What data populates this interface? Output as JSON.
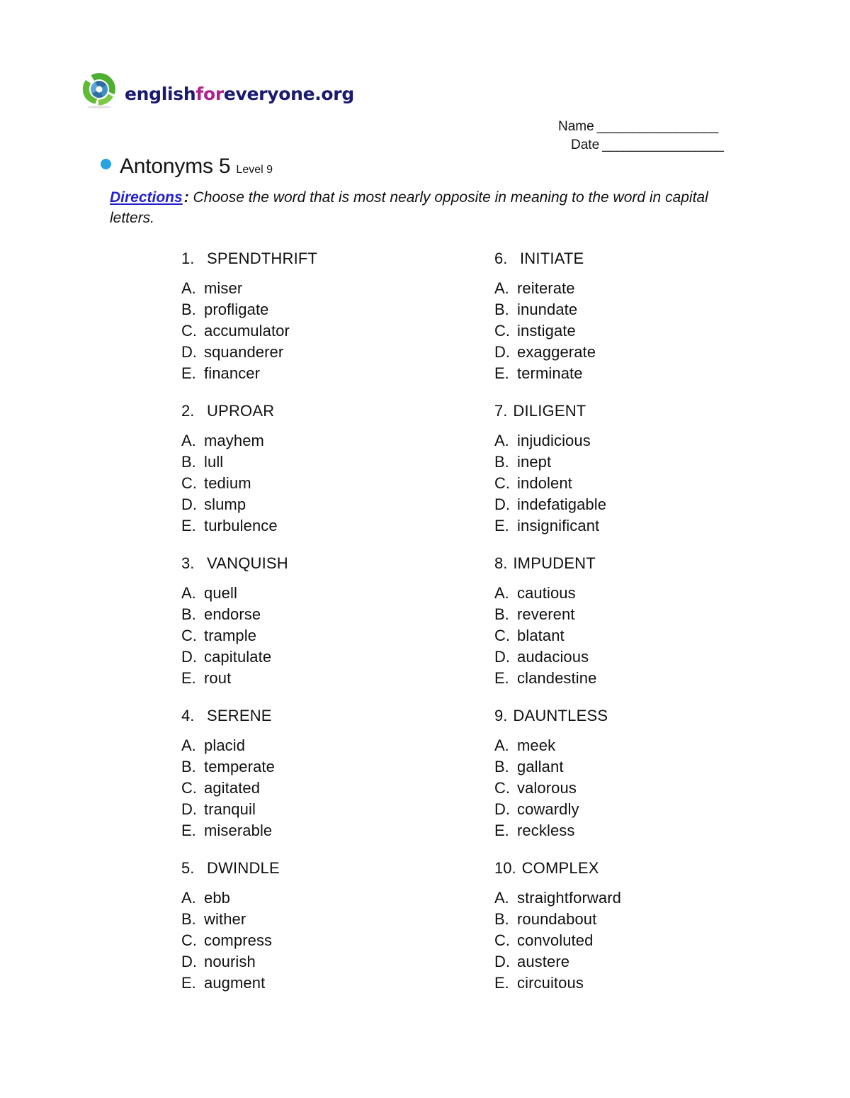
{
  "logo": {
    "icon": "circular-swoosh-logo",
    "word_part1": "english",
    "word_part2": "for",
    "word_part3": "everyone.org",
    "navy": "#1a1a6e",
    "magenta": "#b0228c"
  },
  "header": {
    "name_label": "Name",
    "name_line": "_________________",
    "date_label": "Date",
    "date_line": "_________________"
  },
  "title": {
    "bullet_color": "#29a3e0",
    "main": "Antonyms 5",
    "level": "Level 9"
  },
  "directions": {
    "label": "Directions",
    "colon": ":",
    "text": " Choose the word that is most nearly opposite in meaning to the word in capital letters.",
    "label_color": "#2222cc"
  },
  "questions": [
    {
      "number": "1.",
      "word": "SPENDTHRIFT",
      "options": [
        {
          "letter": "A.",
          "text": "miser"
        },
        {
          "letter": "B.",
          "text": "profligate"
        },
        {
          "letter": "C.",
          "text": "accumulator"
        },
        {
          "letter": "D.",
          "text": "squanderer"
        },
        {
          "letter": "E.",
          "text": "financer"
        }
      ]
    },
    {
      "number": "2.",
      "word": "UPROAR",
      "options": [
        {
          "letter": "A.",
          "text": "mayhem"
        },
        {
          "letter": "B.",
          "text": "lull"
        },
        {
          "letter": "C.",
          "text": "tedium"
        },
        {
          "letter": "D.",
          "text": "slump"
        },
        {
          "letter": "E.",
          "text": "turbulence"
        }
      ]
    },
    {
      "number": "3.",
      "word": "VANQUISH",
      "options": [
        {
          "letter": "A.",
          "text": "quell"
        },
        {
          "letter": "B.",
          "text": "endorse"
        },
        {
          "letter": "C.",
          "text": "trample"
        },
        {
          "letter": "D.",
          "text": "capitulate"
        },
        {
          "letter": "E.",
          "text": "rout"
        }
      ]
    },
    {
      "number": "4.",
      "word": "SERENE",
      "options": [
        {
          "letter": "A.",
          "text": "placid"
        },
        {
          "letter": "B.",
          "text": "temperate"
        },
        {
          "letter": "C.",
          "text": "agitated"
        },
        {
          "letter": "D.",
          "text": "tranquil"
        },
        {
          "letter": "E.",
          "text": "miserable"
        }
      ]
    },
    {
      "number": "5.",
      "word": "DWINDLE",
      "options": [
        {
          "letter": "A.",
          "text": "ebb"
        },
        {
          "letter": "B.",
          "text": "wither"
        },
        {
          "letter": "C.",
          "text": "compress"
        },
        {
          "letter": "D.",
          "text": "nourish"
        },
        {
          "letter": "E.",
          "text": "augment"
        }
      ]
    },
    {
      "number": "6.",
      "word": "INITIATE",
      "options": [
        {
          "letter": "A.",
          "text": "reiterate"
        },
        {
          "letter": "B.",
          "text": "inundate"
        },
        {
          "letter": "C.",
          "text": "instigate"
        },
        {
          "letter": "D.",
          "text": "exaggerate"
        },
        {
          "letter": "E.",
          "text": "terminate"
        }
      ]
    },
    {
      "number": "7.",
      "word": "DILIGENT",
      "options": [
        {
          "letter": "A.",
          "text": "injudicious"
        },
        {
          "letter": "B.",
          "text": "inept"
        },
        {
          "letter": "C.",
          "text": "indolent"
        },
        {
          "letter": "D.",
          "text": "indefatigable"
        },
        {
          "letter": "E.",
          "text": "insignificant"
        }
      ]
    },
    {
      "number": "8.",
      "word": "IMPUDENT",
      "options": [
        {
          "letter": "A.",
          "text": "cautious"
        },
        {
          "letter": "B.",
          "text": "reverent"
        },
        {
          "letter": "C.",
          "text": "blatant"
        },
        {
          "letter": "D.",
          "text": "audacious"
        },
        {
          "letter": "E.",
          "text": "clandestine"
        }
      ]
    },
    {
      "number": "9.",
      "word": "DAUNTLESS",
      "options": [
        {
          "letter": "A.",
          "text": "meek"
        },
        {
          "letter": "B.",
          "text": "gallant"
        },
        {
          "letter": "C.",
          "text": "valorous"
        },
        {
          "letter": "D.",
          "text": "cowardly"
        },
        {
          "letter": "E.",
          "text": "reckless"
        }
      ]
    },
    {
      "number": "10.",
      "word": "COMPLEX",
      "options": [
        {
          "letter": "A.",
          "text": "straightforward"
        },
        {
          "letter": "B.",
          "text": "roundabout"
        },
        {
          "letter": "C.",
          "text": "convoluted"
        },
        {
          "letter": "D.",
          "text": "austere"
        },
        {
          "letter": "E.",
          "text": "circuitous"
        }
      ]
    }
  ]
}
